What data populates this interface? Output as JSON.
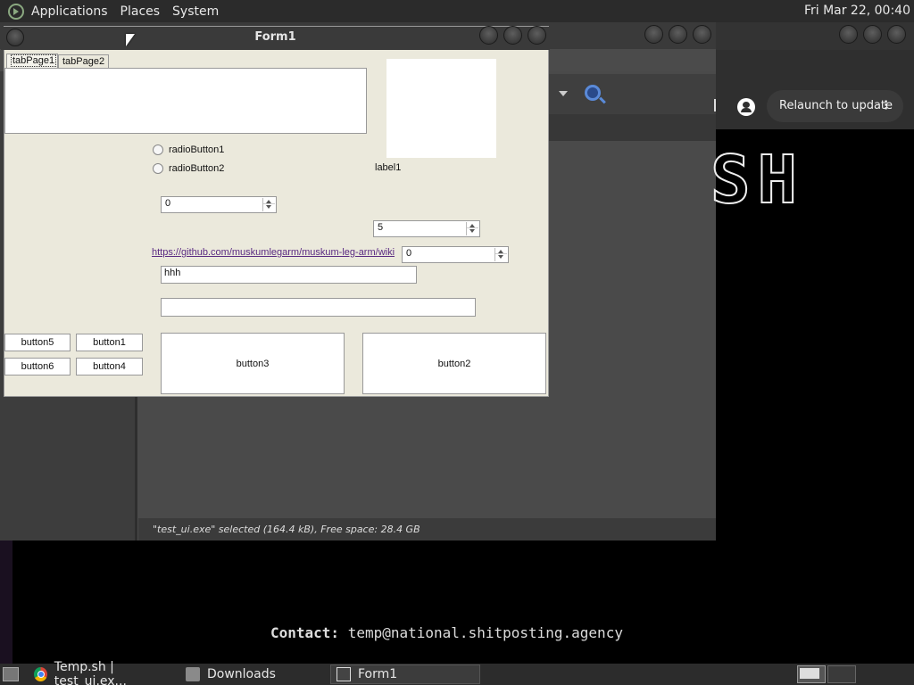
{
  "top_panel": {
    "menus": [
      "Applications",
      "Places",
      "System"
    ],
    "clock": "Fri Mar 22, 00:40"
  },
  "file_manager": {
    "status": "\"test_ui.exe\" selected (164.4 kB), Free space: 28.4 GB"
  },
  "browser": {
    "relaunch_label": "Relaunch to update",
    "relaunch_menu": "⋮",
    "banner_text": "SH"
  },
  "terminal": {
    "contact_label": "Contact:",
    "contact_value": "temp@national.shitposting.agency"
  },
  "form1": {
    "title": "Form1",
    "tabs": [
      "tabPage1",
      "tabPage2"
    ],
    "radio1": "radioButton1",
    "radio2": "radioButton2",
    "label1": "label1",
    "numeric1": "0",
    "numeric2": "5",
    "numeric3": "0",
    "link": "https://github.com/muskumlegarm/muskum-leg-arm/wiki",
    "textbox1": "hhh",
    "textbox2": "",
    "buttons": {
      "button5": "button5",
      "button1": "button1",
      "button6": "button6",
      "button4": "button4",
      "button3": "button3",
      "button2": "button2"
    }
  },
  "taskbar": {
    "tasks": [
      "Temp.sh | test_ui.ex...",
      "Downloads",
      "Form1"
    ]
  }
}
